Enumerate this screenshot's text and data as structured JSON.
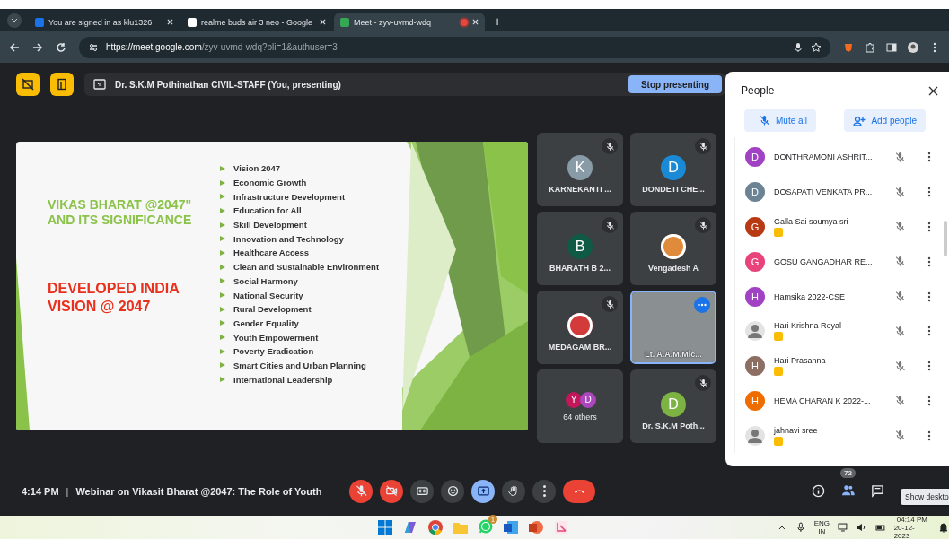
{
  "browser": {
    "tabs": [
      {
        "title": "You are signed in as klu1326",
        "selected": false
      },
      {
        "title": "realme buds air 3 neo - Google",
        "selected": false
      },
      {
        "title": "Meet - zyv-uvmd-wdq",
        "selected": true,
        "recording": true
      }
    ],
    "new_tab": "+",
    "url_host": "https://meet.google.com",
    "url_path": "/zyv-uvmd-wdq?pli=1&authuser=3"
  },
  "presenting": {
    "label": "Dr. S.K.M Pothinathan CIVIL-STAFF (You, presenting)",
    "button": "Stop presenting"
  },
  "slide": {
    "title": "VIKAS BHARAT @2047\"\nAND ITS SIGNIFICANCE",
    "subtitle": "DEVELOPED INDIA\nVISION @ 2047",
    "bullets": [
      "Vision 2047",
      "Economic Growth",
      "Infrastructure Development",
      "Education for All",
      "Skill Development",
      "Innovation and Technology",
      "Healthcare Access",
      "Clean and Sustainable Environment",
      "Social Harmony",
      "National Security",
      "Rural Development",
      "Gender Equality",
      "Youth Empowerment",
      "Poverty Eradication",
      "Smart Cities and Urban Planning",
      "International Leadership"
    ]
  },
  "tiles": [
    {
      "kind": "letter",
      "name": "KARNEKANTI ...",
      "avatar": "K",
      "color": "#8a9ba8",
      "muted": true
    },
    {
      "kind": "letter",
      "name": "DONDETI CHE...",
      "avatar": "D",
      "color": "#1a8ad6",
      "muted": true
    },
    {
      "kind": "letter",
      "name": "BHARATH B 2...",
      "avatar": "B",
      "color": "#0f5a45",
      "muted": true
    },
    {
      "kind": "image",
      "name": "Vengadesh A",
      "color": "#e08a3c",
      "muted": true
    },
    {
      "kind": "image",
      "name": "MEDAGAM BR...",
      "color": "#d33b3b",
      "muted": true
    },
    {
      "kind": "video",
      "name": "Lt. A.A.M.Mic...",
      "muted": false
    },
    {
      "kind": "others",
      "name": "64 others",
      "avatars": [
        {
          "letter": "Y",
          "color": "#c2185b"
        },
        {
          "letter": "D",
          "color": "#ab47bc"
        }
      ],
      "muted": false
    },
    {
      "kind": "letter",
      "name": "Dr. S.K.M Poth...",
      "avatar": "D",
      "color": "#7cb342",
      "muted": true
    }
  ],
  "people": {
    "title": "People",
    "mute_all": "Mute all",
    "add_people": "Add people",
    "participants": [
      {
        "kind": "letter",
        "name": "DONTHRAMONI ASHRIT...",
        "avatar": "D",
        "color": "#a142c4",
        "badge": false
      },
      {
        "kind": "letter",
        "name": "DOSAPATI VENKATA PR...",
        "avatar": "D",
        "color": "#6b8394",
        "badge": false
      },
      {
        "kind": "letter",
        "name": "Galla Sai soumya sri",
        "avatar": "G",
        "color": "#b83a14",
        "badge": true
      },
      {
        "kind": "letter",
        "name": "GOSU GANGADHAR RE...",
        "avatar": "G",
        "color": "#e8437a",
        "badge": false
      },
      {
        "kind": "letter",
        "name": "Hamsika 2022-CSE",
        "avatar": "H",
        "color": "#a142c4",
        "badge": false
      },
      {
        "kind": "photo",
        "name": "Hari Krishna Royal",
        "badge": true
      },
      {
        "kind": "letter",
        "name": "Hari Prasanna",
        "avatar": "H",
        "color": "#8d6e63",
        "badge": true
      },
      {
        "kind": "letter",
        "name": "HEMA CHARAN K 2022-...",
        "avatar": "H",
        "color": "#ef6c00",
        "badge": false
      },
      {
        "kind": "photo",
        "name": "jahnavi sree",
        "badge": true
      }
    ]
  },
  "bottom": {
    "time": "4:14 PM",
    "separator": "|",
    "title": "Webinar on Vikasit Bharat @2047: The Role of Youth",
    "controls": [
      {
        "kind": "mic",
        "on": false
      },
      {
        "kind": "camera",
        "on": false
      },
      {
        "kind": "captions",
        "on": false
      },
      {
        "kind": "emoji",
        "on": false
      },
      {
        "kind": "present",
        "on": true
      },
      {
        "kind": "hand",
        "on": false
      },
      {
        "kind": "more",
        "on": false
      },
      {
        "kind": "leave"
      }
    ],
    "people_count": "72",
    "tooltip": "Show deskto"
  },
  "taskbar": {
    "whatsapp_badge": "1",
    "language": "ENG",
    "region": "IN",
    "time": "04:14 PM",
    "date": "20-12-2023"
  }
}
